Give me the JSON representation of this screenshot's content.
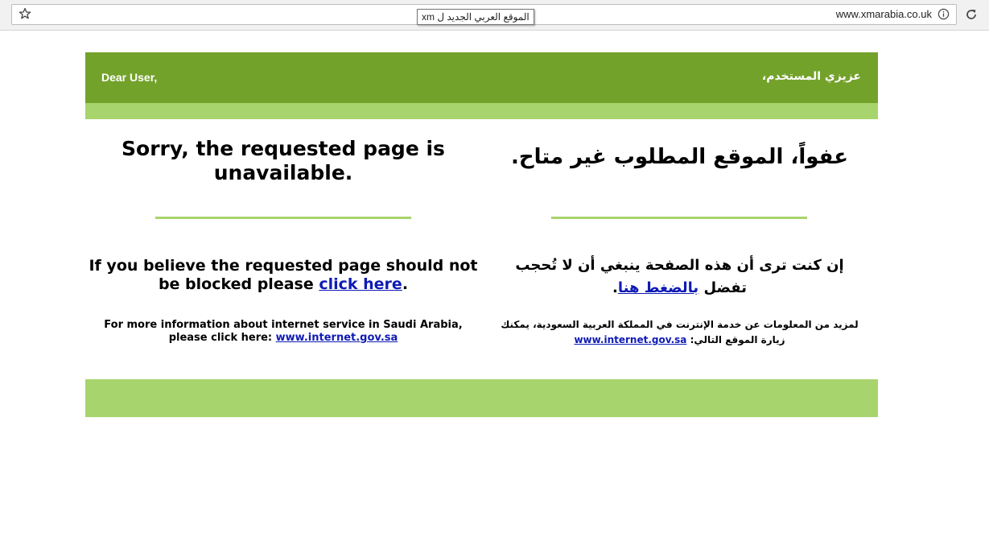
{
  "browser": {
    "url": "www.xmarabia.co.uk",
    "tooltip": "الموقع العربي الجديد ل xm"
  },
  "page": {
    "greeting_en": "Dear User,",
    "greeting_ar": "عزيزي المستخدم،",
    "title_en": "Sorry, the requested page is unavailable.",
    "title_ar": "عفواً، الموقع المطلوب غير متاح.",
    "message_en": {
      "before": "If you believe the requested page should not be blocked please ",
      "link": "click here",
      "after": "."
    },
    "message_ar": {
      "before": "إن كنت ترى أن هذه الصفحة ينبغي أن لا تُحجب تفضل ",
      "link": "بالضغط هنا",
      "after": "."
    },
    "info_en": {
      "text": "For more information about internet service in Saudi Arabia, please click here: ",
      "link": "www.internet.gov.sa"
    },
    "info_ar": {
      "text": "لمزيد من المعلومات عن خدمة الإنترنت في المملكة العربية السعودية، يمكنك زيارة الموقع التالي: ",
      "link": "www.internet.gov.sa"
    }
  },
  "colors": {
    "header_green": "#73a22b",
    "light_green": "#a8d46d",
    "link_blue": "#0f1bb4"
  }
}
